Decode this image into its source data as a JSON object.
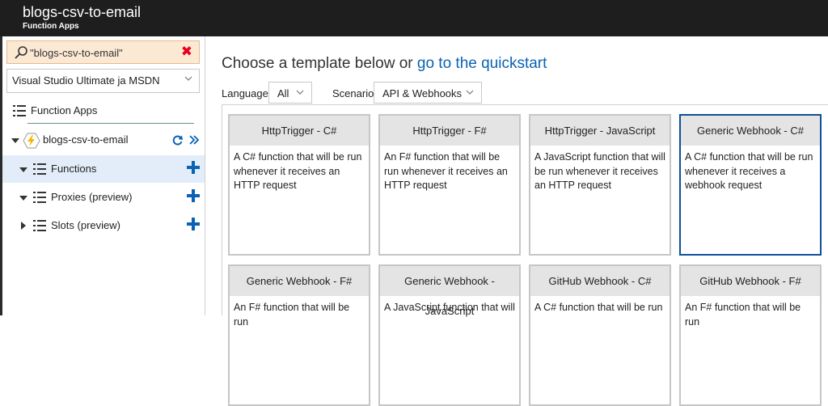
{
  "header": {
    "title": "blogs-csv-to-email",
    "subtitle": "Function Apps"
  },
  "sidebar": {
    "search": {
      "value": "\"blogs-csv-to-email\"",
      "icon": "search-icon",
      "clear_icon": "close-icon",
      "clear_color": "#e8001c"
    },
    "subscription": {
      "value": "Visual Studio Ultimate ja MSDN"
    },
    "function_apps_label": "Function Apps",
    "app": {
      "name": "blogs-csv-to-email"
    },
    "items": [
      {
        "label": "Functions",
        "expanded": true,
        "selected": true
      },
      {
        "label": "Proxies (preview)",
        "expanded": true,
        "selected": false
      },
      {
        "label": "Slots (preview)",
        "expanded": false,
        "selected": false
      }
    ],
    "accent": "#0a62b4"
  },
  "main": {
    "heading_text": "Choose a template below or ",
    "heading_link": "go to the quickstart",
    "language_label": "Language:",
    "language_value": "All",
    "scenario_label": "Scenario:",
    "scenario_value": "API & Webhooks",
    "templates": [
      {
        "title": "HttpTrigger - C#",
        "description": "A C# function that will be run whenever it receives an HTTP request",
        "selected": false
      },
      {
        "title": "HttpTrigger - F#",
        "description": "An F# function that will be run whenever it receives an HTTP request",
        "selected": false
      },
      {
        "title": "HttpTrigger - JavaScript",
        "description": "A JavaScript function that will be run whenever it receives an HTTP request",
        "selected": false
      },
      {
        "title": "Generic Webhook - C#",
        "description": "A C# function that will be run whenever it receives a webhook request",
        "selected": true
      },
      {
        "title": "Generic Webhook - F#",
        "description": "An F# function that will be run",
        "selected": false
      },
      {
        "title": "Generic Webhook - JavaScript",
        "description": "A JavaScript function that will",
        "selected": false
      },
      {
        "title": "GitHub Webhook - C#",
        "description": "A C# function that will be run",
        "selected": false
      },
      {
        "title": "GitHub Webhook - F#",
        "description": "An F# function that will be run",
        "selected": false
      }
    ]
  }
}
